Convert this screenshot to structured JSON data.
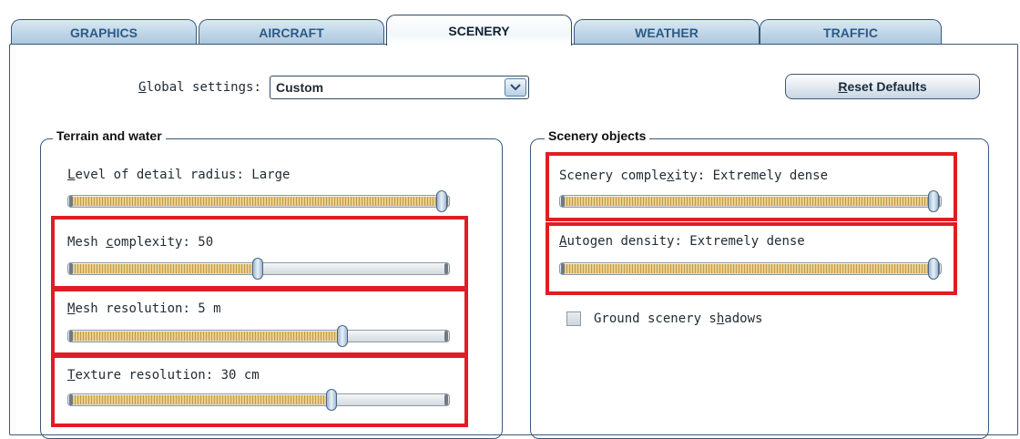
{
  "tabs": [
    "GRAPHICS",
    "AIRCRAFT",
    "SCENERY",
    "WEATHER",
    "TRAFFIC"
  ],
  "active_tab": "SCENERY",
  "global": {
    "label_prefix": "",
    "label_accel": "G",
    "label_rest": "lobal settings:",
    "value": "Custom"
  },
  "reset_button": {
    "accel": "R",
    "rest": "eset Defaults"
  },
  "terrain": {
    "title": "Terrain and water",
    "sliders": [
      {
        "pre": "",
        "accel": "L",
        "post": "evel of detail radius: Large",
        "level": 1.0
      },
      {
        "pre": "Mesh ",
        "accel": "c",
        "post": "omplexity: 50",
        "level": 0.5
      },
      {
        "pre": "",
        "accel": "M",
        "post": "esh resolution: 5 m",
        "level": 0.73
      },
      {
        "pre": "",
        "accel": "T",
        "post": "exture resolution: 30 cm",
        "level": 0.7
      }
    ]
  },
  "scenery_objects": {
    "title": "Scenery objects",
    "sliders": [
      {
        "pre": "Scenery comple",
        "accel": "x",
        "post": "ity: Extremely dense",
        "level": 1.0
      },
      {
        "pre": "",
        "accel": "A",
        "post": "utogen density: Extremely dense",
        "level": 1.0
      }
    ],
    "checkbox": {
      "pre": "Ground scenery s",
      "accel": "h",
      "post": "adows",
      "checked": false
    }
  },
  "colors": {
    "highlight_box": "#e01d23",
    "tab_text": "#2d5a86",
    "slider_fill": "#e9cf8c"
  }
}
